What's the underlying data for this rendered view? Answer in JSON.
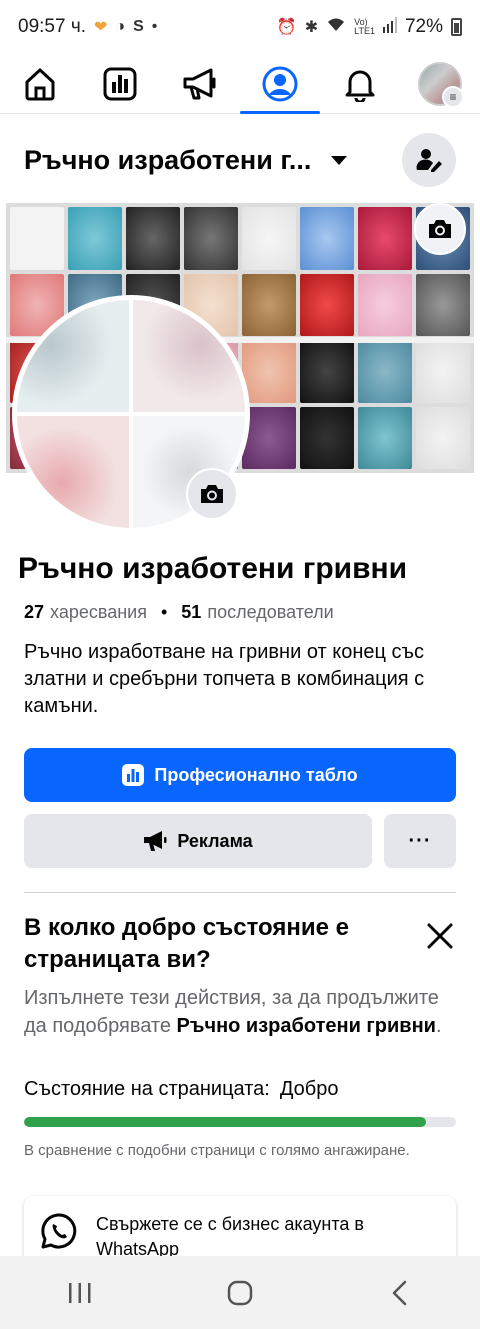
{
  "status_bar": {
    "time": "09:57 ч.",
    "left_icons": [
      "heart-badge-icon",
      "half-circle-icon",
      "signal-s-icon",
      "dot-icon"
    ],
    "right_icons": [
      "alarm-icon",
      "bluetooth-icon",
      "wifi-icon",
      "volte-icon",
      "signal-icon"
    ],
    "battery": "72%"
  },
  "nav": {
    "items": [
      {
        "name": "home-icon"
      },
      {
        "name": "insights-icon"
      },
      {
        "name": "megaphone-icon"
      },
      {
        "name": "profile-icon",
        "active": true
      },
      {
        "name": "bell-icon"
      },
      {
        "name": "avatar-menu-icon"
      }
    ]
  },
  "page": {
    "header_title": "Ръчно изработени г...",
    "name": "Ръчно изработени гривни",
    "likes_count": "27",
    "likes_label": "харесвания",
    "stats_separator": "•",
    "followers_count": "51",
    "followers_label": "последователи",
    "bio": "Ръчно изработване на гривни от конец със златни и сребърни топчета в комбинация с камъни."
  },
  "buttons": {
    "dashboard": "Професионално табло",
    "ads": "Реклама",
    "more": "···"
  },
  "health": {
    "title": "В колко добро състояние е страницата ви?",
    "desc_prefix": "Изпълнете тези действия, за да продължите да подобрявате",
    "desc_page": "Ръчно изработени гривни",
    "desc_suffix": ".",
    "status_label": "Състояние на страницата:",
    "status_value": "Добро",
    "progress": 0.93,
    "compare_note": "В сравнение с подобни страници с голямо ангажиране.",
    "progress_color": "#31a24c"
  },
  "whatsapp": {
    "text": "Свържете се с бизнес акаунта в WhatsApp"
  },
  "colors": {
    "accent": "#0866ff",
    "secondary_bg": "#e4e6eb",
    "muted_text": "#65676b"
  }
}
